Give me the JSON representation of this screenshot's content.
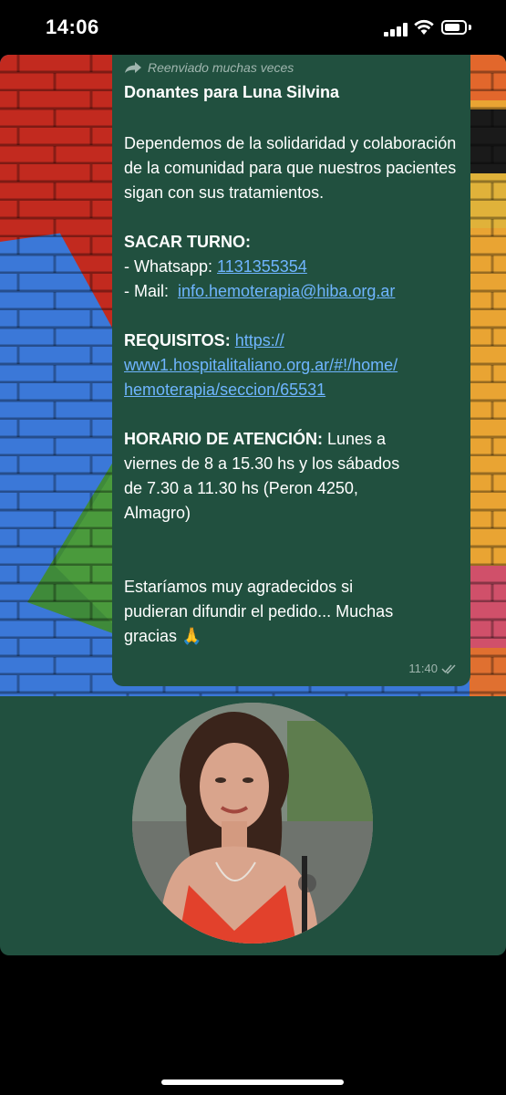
{
  "status_bar": {
    "time": "14:06"
  },
  "message": {
    "forwarded_label": "Reenviado muchas veces",
    "title": "Donantes para Luna Silvina",
    "intro": "Dependemos de la solidaridad y colaboración de la comunidad para que nuestros pacientes sigan con sus tratamientos.",
    "turno_heading": "SACAR TURNO:",
    "whatsapp_label": "- Whatsapp: ",
    "whatsapp_number": "1131355354",
    "mail_label": "- Mail:  ",
    "mail_address": "info.hemoterapia@hiba.org.ar",
    "requisitos_heading": "REQUISITOS:",
    "requisitos_link_line1": "https://",
    "requisitos_link_line2": "www1.hospitalitaliano.org.ar/#!/home/",
    "requisitos_link_line3": "hemoterapia/seccion/65531",
    "horario_heading": "HORARIO DE ATENCIÓN:",
    "horario_text_line1": " Lunes a",
    "horario_text_line2": "viernes de 8 a 15.30 hs y los sábados",
    "horario_text_line3": "de 7.30 a 11.30 hs (Peron 4250,",
    "horario_text_line4": "Almagro)",
    "closing_line1": "Estaríamos muy agradecidos si",
    "closing_line2": "pudieran difundir el pedido... Muchas",
    "closing_line3": "gracias 🙏",
    "time": "11:40"
  },
  "icons": {
    "forward": "forward-icon",
    "ticks": "double-check-icon",
    "signal": "signal-icon",
    "wifi": "wifi-icon",
    "battery": "battery-icon"
  },
  "colors": {
    "bubble": "#21503f",
    "link": "#6fb5ff",
    "wall_red": "#c22a1f",
    "wall_blue": "#3b78d8",
    "wall_green": "#3f8a3a"
  }
}
